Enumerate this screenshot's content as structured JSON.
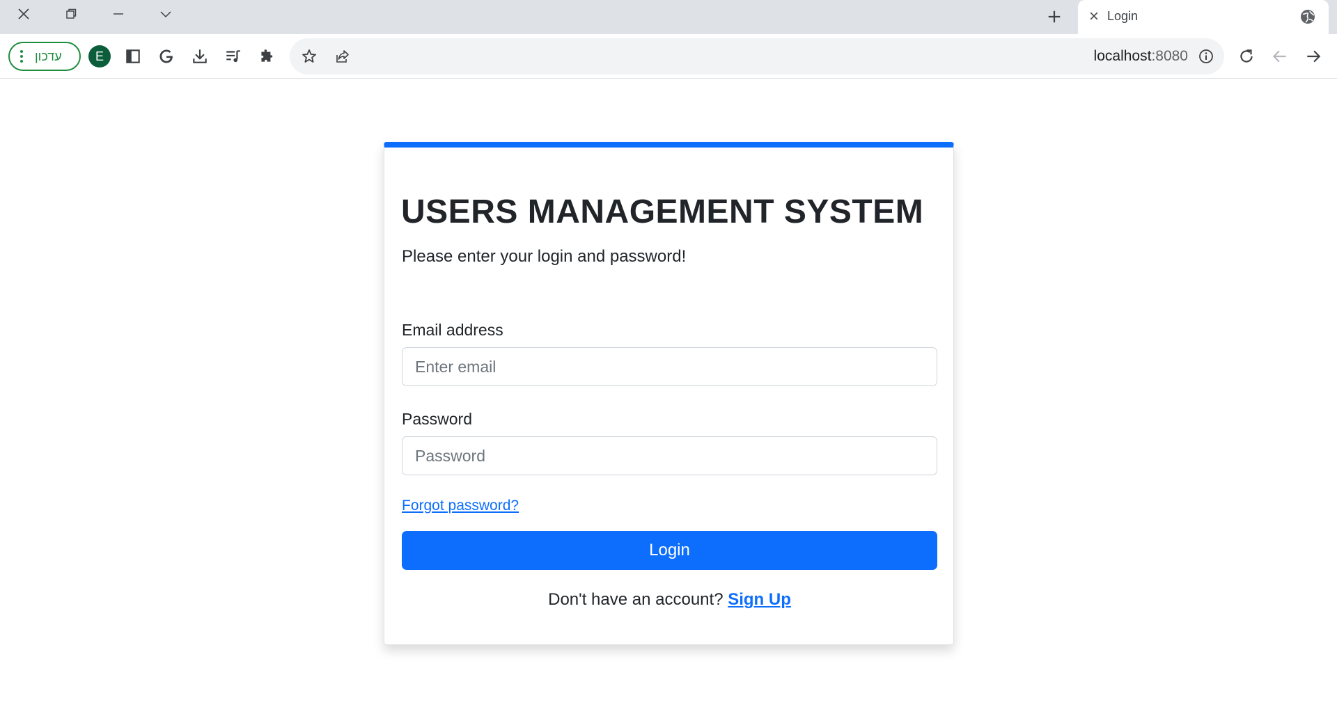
{
  "window": {
    "controls": [
      "close-icon",
      "restore-icon",
      "minimize-icon",
      "tab-search-icon"
    ]
  },
  "tab": {
    "title": "Login",
    "new_tab_icon": "plus-icon",
    "favicon": "globe-icon"
  },
  "toolbar": {
    "update_label": "עדכון",
    "profile_initial": "E",
    "icons": [
      "side-panel-icon",
      "google-icon",
      "download-icon",
      "reading-list-icon",
      "extensions-icon"
    ]
  },
  "omnibox": {
    "host": "localhost",
    "port": ":8080",
    "icons": [
      "bookmark-star-icon",
      "share-icon",
      "site-info-icon"
    ]
  },
  "nav": {
    "icons": [
      "reload-icon",
      "back-icon",
      "forward-icon"
    ]
  },
  "login": {
    "title": "USERS MANAGEMENT SYSTEM",
    "subtitle": "Please enter your login and password!",
    "email_label": "Email address",
    "email_placeholder": "Enter email",
    "password_label": "Password",
    "password_placeholder": "Password",
    "forgot_link": "Forgot password?",
    "submit_label": "Login",
    "signup_prompt": "Don't have an account?",
    "signup_link": "Sign Up"
  },
  "colors": {
    "primary": "#0d6efd",
    "update_green": "#1e8e3e",
    "profile_bg": "#0b5d3b"
  }
}
